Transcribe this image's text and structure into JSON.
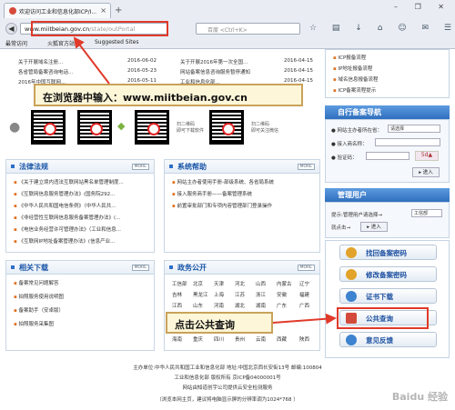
{
  "browser": {
    "tab_title": "欢迎访问工业和信息化部ICP/I...",
    "tab_close": "×",
    "new_tab": "+",
    "window_controls": "–  ❐  ✕",
    "back": "◀",
    "url_main": "www.miitbeian.gov.cn",
    "url_rest": "/state/outPortal",
    "search_placeholder": "百度 <Ctrl+K>",
    "bookmarks": [
      "最常访问",
      "火狐官方站点",
      "Suggested Sites"
    ]
  },
  "callouts": {
    "url_hint": "在浏览器中输入：www.miitbeian.gov.cn",
    "query_hint": "点击公共查询"
  },
  "news": [
    {
      "left": "关于开展域名注册...",
      "left_date": "2016-06-02",
      "right": "关于开展2016年第一次全国...",
      "right_date": "2016-04-15"
    },
    {
      "left": "各省管局备案咨询电话...",
      "left_date": "2016-05-23",
      "right": "网站备案信息咨询服务暂停通知",
      "right_date": "2016-04-15"
    },
    {
      "left": "2016年中国互联网...",
      "left_date": "2016-05-11",
      "right": "工业和信息化部...",
      "right_date": "2016-04-15"
    }
  ],
  "qr": {
    "left_label_1": "扫二维码",
    "left_label_2": "即可下载软件",
    "right_label_1": "扫二维码",
    "right_label_2": "即可关注微信"
  },
  "law": {
    "title": "法律法规",
    "more": "MORE",
    "items": [
      "《关于建立境内违法互联网站黑名单管理制度...",
      "《互联网信息服务管理办法》(国务院292...",
      "《中华人民共和国电信条例》（中华人民共...",
      "《非经营性互联网信息服务备案管理办法》(...",
      "《电信业务经营许可管理办法》（工业和信息...",
      "《互联网IP地址备案管理办法》(信息产业..."
    ]
  },
  "help": {
    "title": "系统帮助",
    "more": "MORE",
    "items": [
      "网站主办者使用手册-部级系统、各省局系统",
      "接入服务商手册——备案管理系统",
      "前置审批部门和专项内容管理部门登录操作"
    ]
  },
  "download": {
    "title": "相关下载",
    "more": "MORE",
    "items": [
      "备案常见问题解答",
      "拍照服务使用说明图",
      "备案助手（安卓版）",
      "拍照服务采集图"
    ]
  },
  "gov": {
    "title": "政务公开",
    "more": "MORE",
    "provinces": [
      [
        "工信部",
        "北京",
        "天津",
        "河北",
        "山西",
        "内蒙古",
        "辽宁"
      ],
      [
        "吉林",
        "黑龙江",
        "上海",
        "江苏",
        "浙江",
        "安徽",
        "福建"
      ],
      [
        "江西",
        "山东",
        "河南",
        "湖北",
        "湖南",
        "广东",
        "广西"
      ],
      [
        "海南",
        "重庆",
        "四川",
        "贵州",
        "云南",
        "西藏",
        "陕西"
      ]
    ]
  },
  "side_top_links": [
    "ICP报备流程",
    "IP地址报备流程",
    "域名信息报备流程",
    "ICP备案流程提示"
  ],
  "nav": {
    "title": "自行备案导航",
    "province_label": "● 网站主办者所在省：",
    "province_value": "请选择",
    "cert_label": "● 接入商名称：",
    "code_label": "● 验证码：",
    "code_img": "5d▲",
    "go": "▸ 进入"
  },
  "admin": {
    "title": "管理用户",
    "hint": "提示:管理用户请选择→",
    "select_value": "工信部",
    "go_label": "就点击→",
    "go": "▸ 进入"
  },
  "side_buttons": [
    {
      "label": "找回备案密码",
      "color": "#e2a32a"
    },
    {
      "label": "修改备案密码",
      "color": "#e2a32a"
    },
    {
      "label": "证书下载",
      "color": "#3d83cf"
    },
    {
      "label": "公共查询",
      "color": "#d44a3a"
    },
    {
      "label": "意见反馈",
      "color": "#3d83cf"
    }
  ],
  "footer": [
    "主办单位:中华人民共和国工业和信息化部 地址:中国北京西长安街13号 邮编:100804",
    "工业和信息化部 版权所有 京ICP备04000001号",
    "网站由知道创宇公司提供云安全检测服务",
    "（浏览本网主页，建议将电脑显示屏的分辨率调为1024*768 ）"
  ],
  "watermark": "Baidu 经验"
}
